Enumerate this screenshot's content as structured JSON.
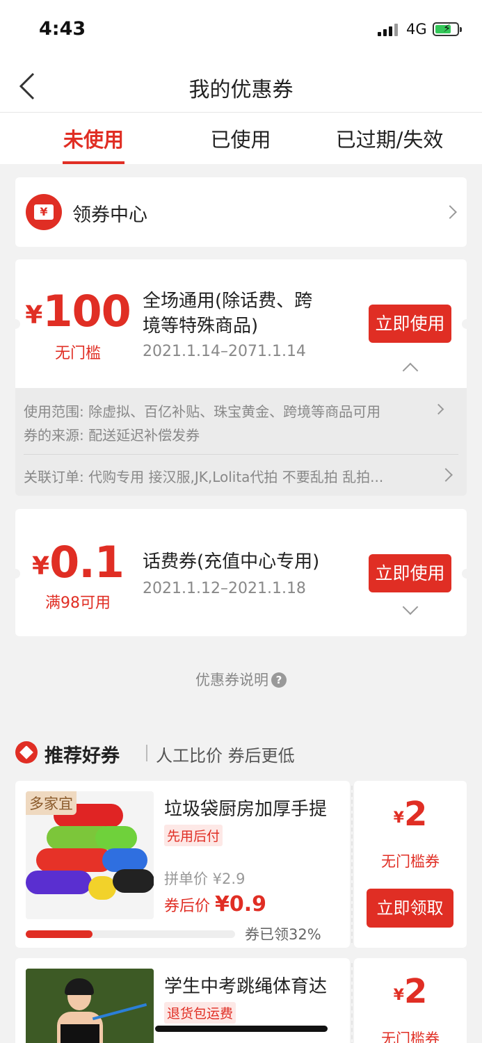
{
  "status_bar": {
    "time": "4:43",
    "network": "4G",
    "battery_icon": "battery-charging-icon"
  },
  "nav": {
    "title": "我的优惠券",
    "back_icon": "chevron-left-icon"
  },
  "tabs": [
    {
      "label": "未使用",
      "active": true
    },
    {
      "label": "已使用",
      "active": false
    },
    {
      "label": "已过期/失效",
      "active": false
    }
  ],
  "coupon_center": {
    "label": "领券中心",
    "icon": "coupon-ticket-icon"
  },
  "coupons": [
    {
      "currency": "¥",
      "amount": "100",
      "condition": "无门槛",
      "title_line1": "全场通用(除话费、跨",
      "title_line2": "境等特殊商品)",
      "date": "2021.1.14–2071.1.14",
      "button": "立即使用",
      "expanded": true,
      "details": {
        "scope_label": "使用范围:",
        "scope_value": "除虚拟、百亿补贴、珠宝黄金、跨境等商品可用",
        "source_label": "券的来源:",
        "source_value": "配送延迟补偿发券",
        "order_label": "关联订单:",
        "order_value": "代购专用 接汉服,JK,Lolita代拍 不要乱拍 乱拍..."
      }
    },
    {
      "currency": "¥",
      "amount": "0.1",
      "condition": "满98可用",
      "title_line1": "话费券(充值中心专用)",
      "date": "2021.1.12–2021.1.18",
      "button": "立即使用",
      "expanded": false
    }
  ],
  "explain": {
    "label": "优惠券说明",
    "icon": "question-circle-icon"
  },
  "recommend": {
    "title": "推荐好券",
    "subtitle": "人工比价 券后更低",
    "items": [
      {
        "badge": "多家宜",
        "name": "垃圾袋厨房加厚手提",
        "tag": "先用后付",
        "group_price": "拼单价 ¥2.9",
        "after_label": "券后价",
        "after_price": "¥0.9",
        "claimed_text": "券已领32%",
        "claimed_fraction": 0.32,
        "coupon_currency": "¥",
        "coupon_amount": "2",
        "coupon_condition": "无门槛券",
        "button": "立即领取"
      },
      {
        "name": "学生中考跳绳体育达",
        "tag": "退货包运费",
        "coupon_currency": "¥",
        "coupon_amount": "2",
        "coupon_condition": "无门槛券"
      }
    ]
  },
  "colors": {
    "accent": "#e02e24",
    "background": "#f2f2f2",
    "muted": "#888888"
  }
}
